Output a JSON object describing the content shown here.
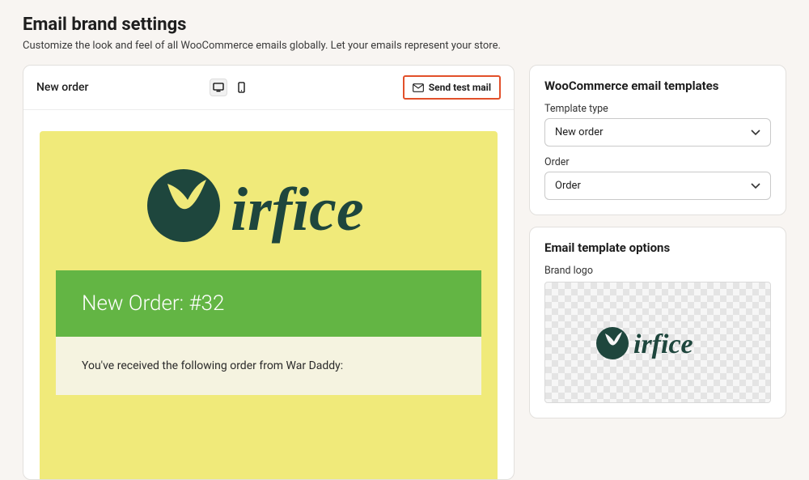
{
  "header": {
    "title": "Email brand settings",
    "subtitle": "Customize the look and feel of all WooCommerce emails globally. Let your emails represent your store."
  },
  "preview": {
    "title": "New order",
    "send_test_label": "Send test mail",
    "brand_name": "Virfice",
    "order_banner": "New Order: #32",
    "order_body": "You've received the following order from War Daddy:"
  },
  "templates": {
    "section_title": "WooCommerce email templates",
    "type_label": "Template type",
    "type_value": "New order",
    "order_label": "Order",
    "order_value": "Order"
  },
  "options": {
    "section_title": "Email template options",
    "brand_logo_label": "Brand logo",
    "brand_name": "Virfice"
  },
  "colors": {
    "brand": "#1e463d"
  }
}
